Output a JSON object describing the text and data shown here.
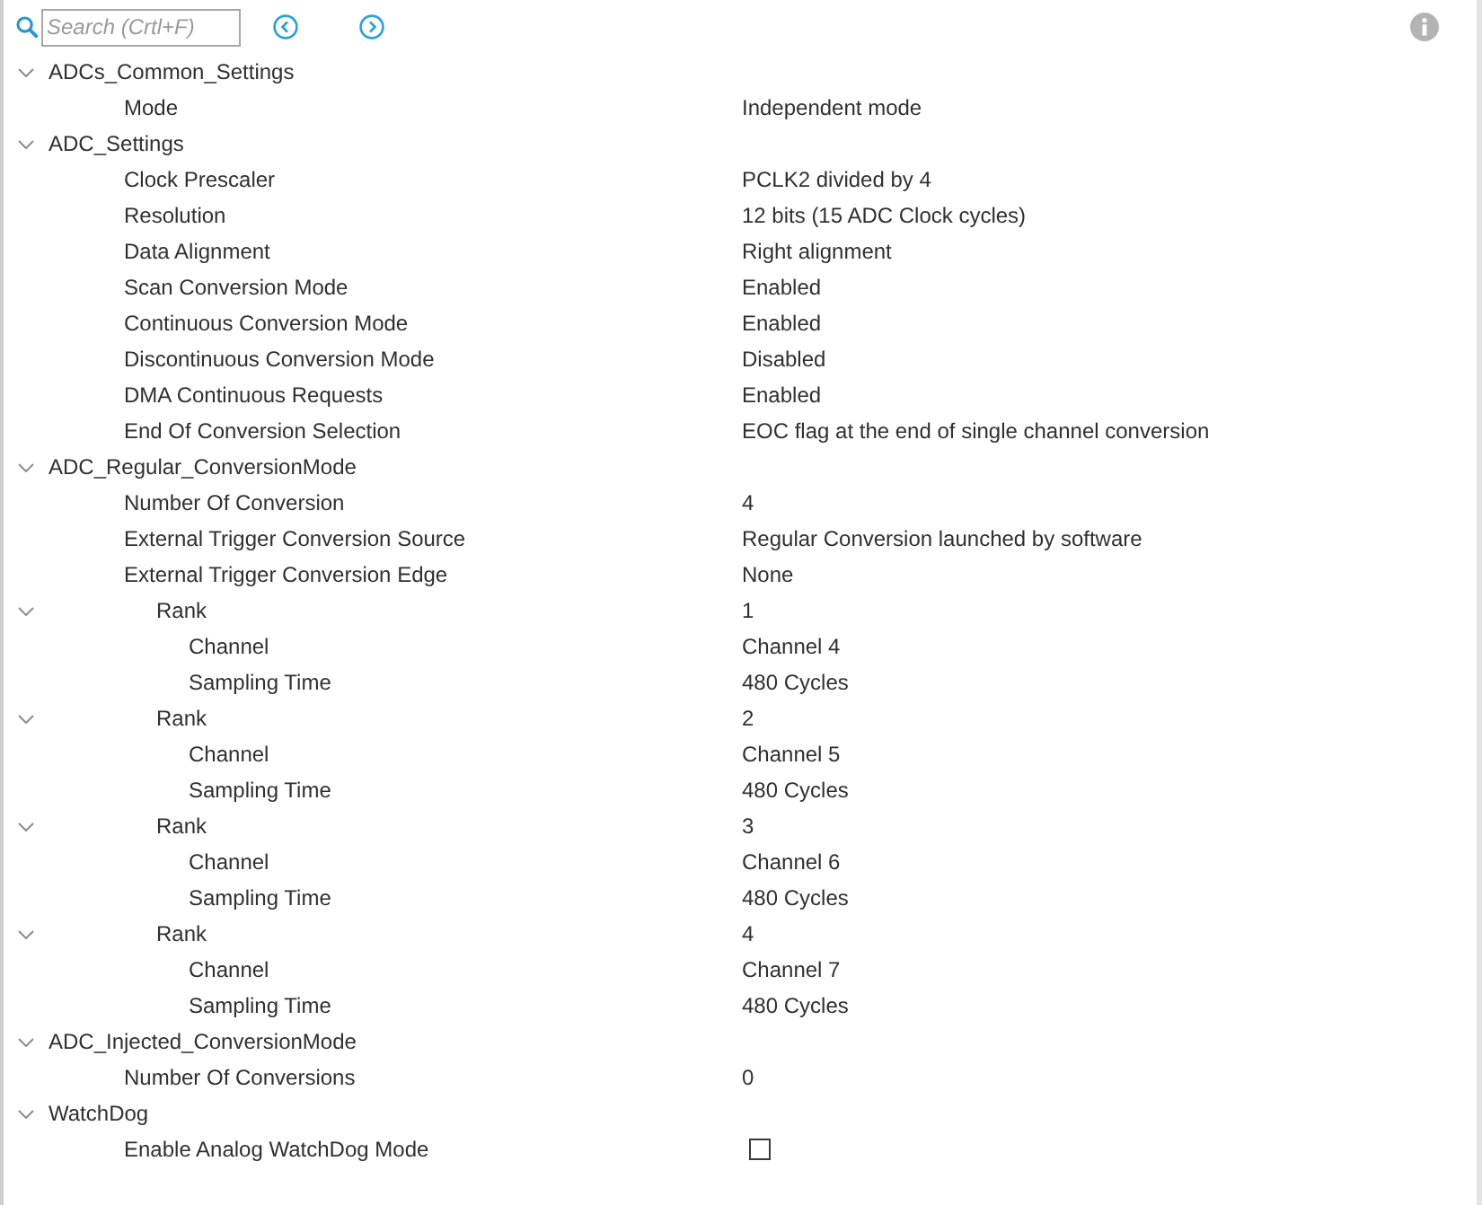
{
  "search": {
    "placeholder": "Search (Crtl+F)"
  },
  "tree": [
    {
      "label": "ADCs_Common_Settings",
      "expanded": true,
      "children": [
        {
          "kind": "text",
          "label": "Mode",
          "value": "Independent mode"
        }
      ]
    },
    {
      "label": "ADC_Settings",
      "expanded": true,
      "children": [
        {
          "kind": "text",
          "label": "Clock Prescaler",
          "value": "PCLK2 divided by 4"
        },
        {
          "kind": "text",
          "label": "Resolution",
          "value": "12 bits (15 ADC Clock cycles)"
        },
        {
          "kind": "text",
          "label": "Data Alignment",
          "value": "Right alignment"
        },
        {
          "kind": "text",
          "label": "Scan Conversion Mode",
          "value": "Enabled"
        },
        {
          "kind": "text",
          "label": "Continuous Conversion Mode",
          "value": "Enabled"
        },
        {
          "kind": "text",
          "label": "Discontinuous Conversion Mode",
          "value": "Disabled"
        },
        {
          "kind": "text",
          "label": "DMA Continuous Requests",
          "value": "Enabled"
        },
        {
          "kind": "text",
          "label": "End Of Conversion Selection",
          "value": "EOC flag at the end of single channel conversion"
        }
      ]
    },
    {
      "label": "ADC_Regular_ConversionMode",
      "expanded": true,
      "children": [
        {
          "kind": "text",
          "label": "Number Of Conversion",
          "value": "4"
        },
        {
          "kind": "text",
          "label": "External Trigger Conversion Source",
          "value": "Regular Conversion launched by software"
        },
        {
          "kind": "text",
          "label": "External Trigger Conversion Edge",
          "value": "None"
        },
        {
          "kind": "text",
          "label": "Rank",
          "value": "1",
          "expanded": true,
          "children": [
            {
              "kind": "text",
              "label": "Channel",
              "value": "Channel 4"
            },
            {
              "kind": "text",
              "label": "Sampling Time",
              "value": "480 Cycles"
            }
          ]
        },
        {
          "kind": "text",
          "label": "Rank",
          "value": "2",
          "expanded": true,
          "children": [
            {
              "kind": "text",
              "label": "Channel",
              "value": "Channel 5"
            },
            {
              "kind": "text",
              "label": "Sampling Time",
              "value": "480 Cycles"
            }
          ]
        },
        {
          "kind": "text",
          "label": "Rank",
          "value": "3",
          "expanded": true,
          "children": [
            {
              "kind": "text",
              "label": "Channel",
              "value": "Channel 6"
            },
            {
              "kind": "text",
              "label": "Sampling Time",
              "value": "480 Cycles"
            }
          ]
        },
        {
          "kind": "text",
          "label": "Rank",
          "value": "4",
          "expanded": true,
          "children": [
            {
              "kind": "text",
              "label": "Channel",
              "value": "Channel 7"
            },
            {
              "kind": "text",
              "label": "Sampling Time",
              "value": "480 Cycles"
            }
          ]
        }
      ]
    },
    {
      "label": "ADC_Injected_ConversionMode",
      "expanded": true,
      "children": [
        {
          "kind": "text",
          "label": "Number Of Conversions",
          "value": "0"
        }
      ]
    },
    {
      "label": "WatchDog",
      "expanded": true,
      "children": [
        {
          "kind": "checkbox",
          "label": "Enable Analog WatchDog Mode",
          "checked": false
        }
      ]
    }
  ]
}
